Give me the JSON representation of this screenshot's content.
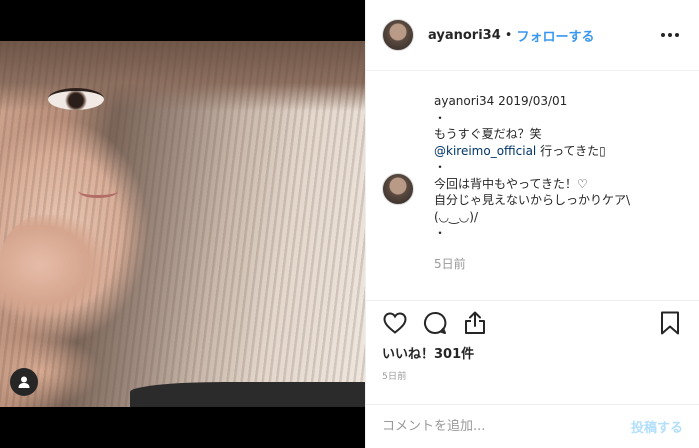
{
  "header": {
    "username": "ayanori34",
    "separator": "•",
    "follow_label": "フォローする"
  },
  "comment": {
    "username": "ayanori34",
    "date": "2019/03/01",
    "line1": "・",
    "line2": "もうすぐ夏だね？笑",
    "mention": "@kireimo_official",
    "line3_suffix": " 行ってきた▯",
    "line4": "・",
    "line5": "今回は背中もやってきた！♡",
    "line6": "自分じゃ見えないからしっかりケア\\",
    "line7": "(◡‿◡)/",
    "line8": "・",
    "time_ago": "5日前"
  },
  "likes": "いいね！301件",
  "post_date": "5日前",
  "comment_box": {
    "placeholder": "コメントを追加...",
    "post_label": "投稿する"
  },
  "icons": {
    "user_tag": "user-tag-icon",
    "more": "more-options-icon",
    "like": "heart-icon",
    "comment": "comment-icon",
    "share": "share-icon",
    "save": "bookmark-icon"
  },
  "colors": {
    "link": "#3897f0",
    "mention": "#003569",
    "muted": "#999999",
    "text": "#262626"
  }
}
